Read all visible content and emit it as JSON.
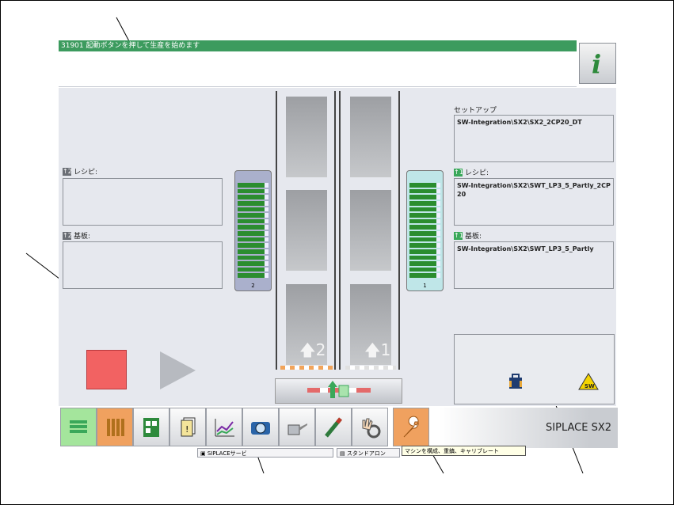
{
  "status": {
    "message": "31901 起動ボタンを押して生産を始めます"
  },
  "left_lane": {
    "recipe_label": "レシピ:",
    "board_label": "基板:",
    "recipe_value": "",
    "board_value": ""
  },
  "right_lane": {
    "setup_label": "セットアップ",
    "setup_value": "SW-Integration\\SX2\\SX2_2CP20_DT",
    "recipe_label": "レシピ:",
    "recipe_value": "SW-Integration\\SX2\\SWT_LP3_5_Partly_2CP20",
    "board_label": "基板:",
    "board_value": "SW-Integration\\SX2\\SWT_LP3_5_Partly"
  },
  "conveyor": {
    "lane_left": "2",
    "lane_right": "1"
  },
  "stacks": {
    "left_number": "2",
    "right_number": "1"
  },
  "taskbar": {
    "machine_name": "SIPLACE SX2",
    "buttons": [
      "production-icon",
      "feeder-table-icon",
      "station-view-icon",
      "message-list-icon",
      "statistics-icon",
      "camera-icon",
      "oil-can-icon",
      "nozzle-tool-icon",
      "hand-gear-icon",
      "wrench-icon"
    ],
    "tooltip": "マシンを構成、重鎮、キャリブレート"
  },
  "bottom": {
    "item1": "SIPLACEサービ",
    "item2": "スタンドアロン"
  },
  "colors": {
    "status_green": "#3c9b5e",
    "stop_red": "#f26262",
    "stack_bar_green": "#2b8d2f",
    "active_orange": "#f0a15f",
    "active_green": "#a4e59c"
  }
}
